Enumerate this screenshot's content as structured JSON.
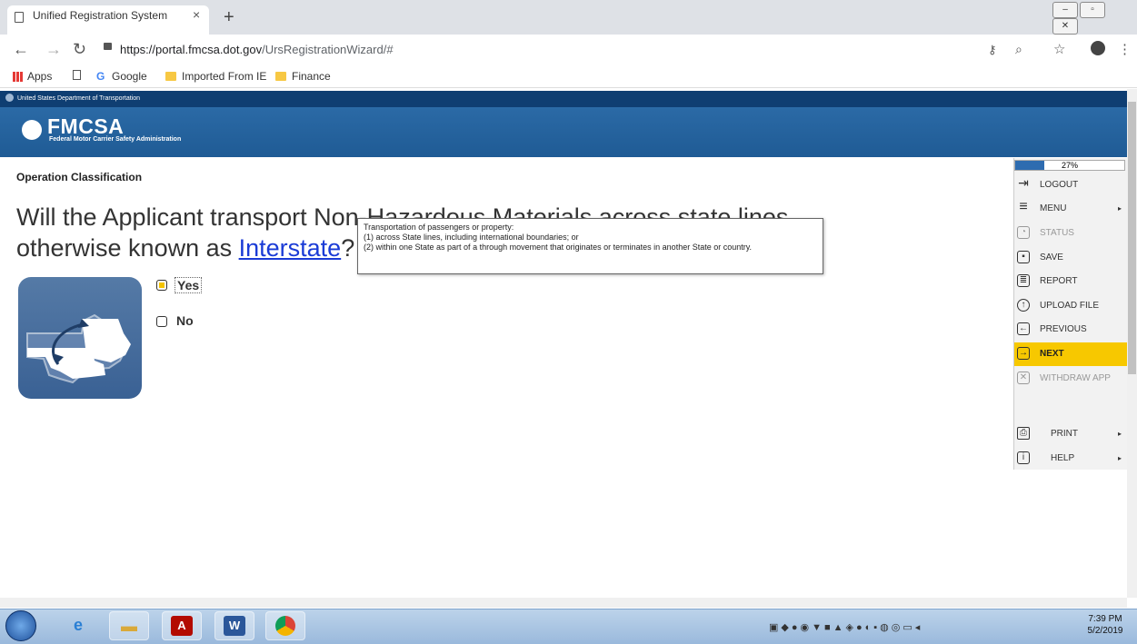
{
  "browser": {
    "tab_title": "Unified Registration System",
    "tab_close": "×",
    "new_tab": "+",
    "url_host": "https://portal.fmcsa.dot.gov",
    "url_path": "/UrsRegistrationWizard/#",
    "bookmarks": [
      "Apps",
      "Google",
      "Imported From IE",
      "Finance"
    ]
  },
  "header": {
    "dot_label": "United States Department of Transportation",
    "title": "FMCSA",
    "subtitle": "Federal Motor Carrier Safety Administration"
  },
  "page": {
    "section_title": "Operation Classification",
    "question_before": "Will the Applicant transport Non-Hazardous Materials across state lines",
    "question_line2_before": "otherwise known as ",
    "question_link": "Interstate",
    "question_after": "?",
    "tooltip": [
      "Transportation of passengers or property:",
      "(1) across State lines, including international boundaries; or",
      "(2) within one State as part of a through movement that originates or terminates in another State or country."
    ],
    "options": [
      {
        "label": "Yes",
        "checked": true
      },
      {
        "label": "No",
        "checked": false
      }
    ]
  },
  "side_menu": {
    "progress_value": 27,
    "progress_label": "27%",
    "items": [
      {
        "label": "LOGOUT",
        "icon": "logout-icon"
      },
      {
        "label": "MENU",
        "icon": "menu-icon",
        "caret": "▸"
      },
      {
        "label": "STATUS",
        "icon": "status-icon",
        "disabled": true
      },
      {
        "label": "SAVE",
        "icon": "save-icon"
      },
      {
        "label": "REPORT",
        "icon": "report-icon"
      },
      {
        "label": "UPLOAD FILE",
        "icon": "upload-icon"
      },
      {
        "label": "PREVIOUS",
        "icon": "previous-icon"
      },
      {
        "label": "NEXT",
        "icon": "next-icon",
        "active": true
      },
      {
        "label": "WITHDRAW APP",
        "icon": "withdraw-icon",
        "disabled": true
      }
    ],
    "print_label": "PRINT",
    "help_label": "HELP"
  },
  "taskbar": {
    "time": "7:39 PM",
    "date": "5/2/2019"
  },
  "colors": {
    "accent_next": "#f7c800",
    "header_blue": "#1f5b95",
    "link_blue": "#1a3bd6"
  }
}
